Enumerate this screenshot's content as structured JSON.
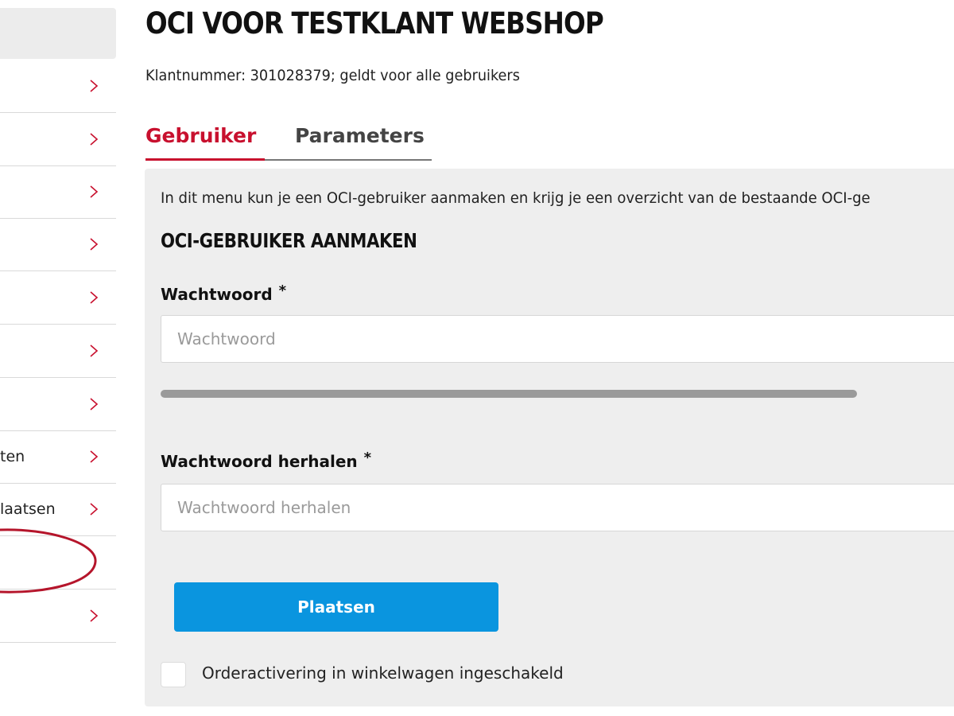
{
  "sidebar": {
    "items": [
      {
        "label": ""
      },
      {
        "label": ""
      },
      {
        "label": ""
      },
      {
        "label": ""
      },
      {
        "label": ""
      },
      {
        "label": ""
      },
      {
        "label": ""
      },
      {
        "label": "ten"
      },
      {
        "label": "laatsen"
      },
      {
        "label": ""
      },
      {
        "label": ""
      }
    ],
    "highlight_color": "#b5152b"
  },
  "page": {
    "title": "OCI VOOR TESTKLANT WEBSHOP",
    "subtitle": "Klantnummer: 301028379; geldt voor alle gebruikers"
  },
  "tabs": [
    {
      "label": "Gebruiker",
      "active": true
    },
    {
      "label": "Parameters",
      "active": false
    }
  ],
  "form": {
    "intro": "In dit menu kun je een OCI-gebruiker aanmaken en krijg je een overzicht van de bestaande OCI-ge",
    "section_title": "OCI-GEBRUIKER AANMAKEN",
    "password": {
      "label": "Wachtwoord",
      "required_mark": "*",
      "placeholder": "Wachtwoord",
      "value": ""
    },
    "password_strength": 0,
    "repeat": {
      "label": "Wachtwoord herhalen",
      "required_mark": "*",
      "placeholder": "Wachtwoord herhalen",
      "value": ""
    },
    "submit_label": "Plaatsen",
    "checkbox": {
      "label": "Orderactivering in winkelwagen ingeschakeld",
      "checked": false
    }
  },
  "colors": {
    "accent": "#c8102e",
    "button": "#0a95df",
    "panel": "#eeeeee"
  }
}
